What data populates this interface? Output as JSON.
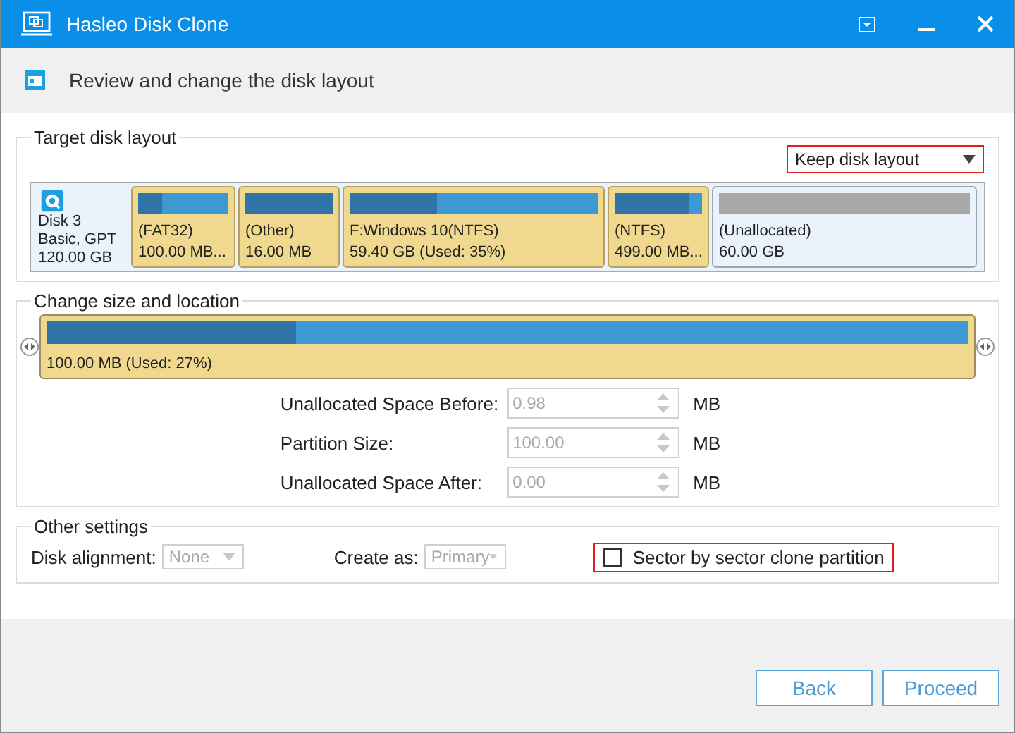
{
  "window": {
    "title": "Hasleo Disk Clone"
  },
  "header": {
    "text": "Review and change the disk layout"
  },
  "target_layout": {
    "title": "Target disk layout",
    "layout_select": {
      "value": "Keep disk layout",
      "highlighted": true
    },
    "disk": {
      "name": "Disk 3",
      "type": "Basic, GPT",
      "size": "120.00 GB"
    },
    "partitions": [
      {
        "kind": "partition",
        "label": "(FAT32)",
        "size": "100.00 MB...",
        "level": 0.27
      },
      {
        "kind": "partition",
        "label": "(Other)",
        "size": "16.00 MB",
        "level": 1
      },
      {
        "kind": "partition",
        "label": "F:Windows 10(NTFS)",
        "size": "59.40 GB (Used: 35%)",
        "level": 0.35
      },
      {
        "kind": "partition",
        "label": "(NTFS)",
        "size": "499.00 MB...",
        "level": 0.85
      },
      {
        "kind": "unallocated",
        "label": "(Unallocated)",
        "size": "60.00 GB"
      }
    ]
  },
  "size_location": {
    "title": "Change size and location",
    "partition": {
      "text": "100.00 MB (Used: 27%)",
      "level": 0.27
    },
    "fields": [
      {
        "label": "Unallocated Space Before:",
        "value": "0.98",
        "unit": "MB",
        "disabled": true
      },
      {
        "label": "Partition Size:",
        "value": "100.00",
        "unit": "MB",
        "disabled": true
      },
      {
        "label": "Unallocated Space After:",
        "value": "0.00",
        "unit": "MB",
        "disabled": true
      }
    ]
  },
  "other_settings": {
    "title": "Other settings",
    "selects": [
      {
        "label": "Disk alignment:",
        "value": "None",
        "disabled": true
      },
      {
        "label": "Create as:",
        "value": "Primary",
        "disabled": true
      }
    ],
    "checkbox": {
      "label": "Sector by sector clone partition",
      "checked": false,
      "highlighted": true
    }
  },
  "buttons": [
    {
      "label": "Back"
    },
    {
      "label": "Proceed"
    }
  ]
}
